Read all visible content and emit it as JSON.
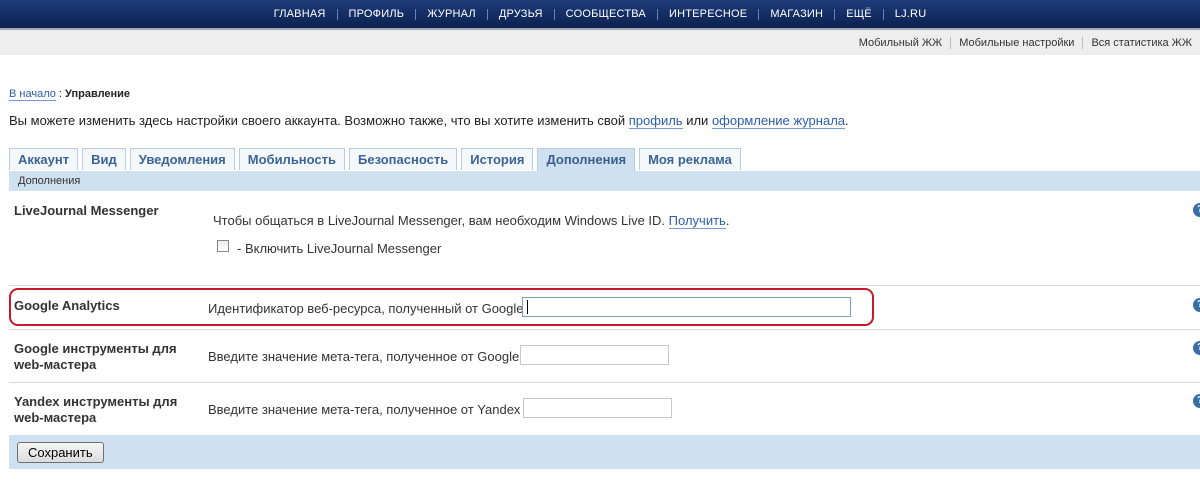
{
  "topnav": {
    "items": [
      "ГЛАВНАЯ",
      "ПРОФИЛЬ",
      "ЖУРНАЛ",
      "ДРУЗЬЯ",
      "СООБЩЕСТВА",
      "ИНТЕРЕСНОЕ",
      "МАГАЗИН",
      "ЕЩЁ",
      "LJ.RU"
    ]
  },
  "subnav": {
    "links": [
      "Мобильный ЖЖ",
      "Мобильные настройки",
      "Вся статистика ЖЖ"
    ]
  },
  "breadcrumb": {
    "home": "В начало",
    "separator": ":",
    "current": "Управление"
  },
  "intro": {
    "text_before": "Вы можете изменить здесь настройки своего аккаунта. Возможно также, что вы хотите изменить свой",
    "profile_link": "профиль",
    "or": "или",
    "design_link": "оформление журнала",
    "period": "."
  },
  "tabs": [
    "Аккаунт",
    "Вид",
    "Уведомления",
    "Мобильность",
    "Безопасность",
    "История",
    "Дополнения",
    "Моя реклама"
  ],
  "active_tab": "Дополнения",
  "section_title": "Дополнения",
  "messenger": {
    "title": "LiveJournal Messenger",
    "desc": "Чтобы общаться в LiveJournal Messenger, вам необходим Windows Live ID.",
    "get_link": "Получить",
    "period": ".",
    "checkbox_label": "- Включить LiveJournal Messenger",
    "checked": false
  },
  "google_analytics": {
    "title": "Google Analytics",
    "desc": "Идентификатор веб-ресурса, полученный от Google",
    "value": ""
  },
  "google_webmaster": {
    "title_line1": "Google инструменты для",
    "title_line2": "web-мастера",
    "desc": "Введите значение мета-тега, полученное от Google",
    "value": ""
  },
  "yandex_webmaster": {
    "title_line1": "Yandex инструменты для",
    "title_line2": "web-мастера",
    "desc": "Введите значение мета-тега, полученное от Yandex",
    "value": ""
  },
  "help_icon": "?",
  "save_label": "Сохранить",
  "colors": {
    "nav_bg": "#0c2050",
    "tab_active_bg": "#cfe0f0",
    "highlight": "#c41a2a",
    "link": "#2a5db0"
  }
}
